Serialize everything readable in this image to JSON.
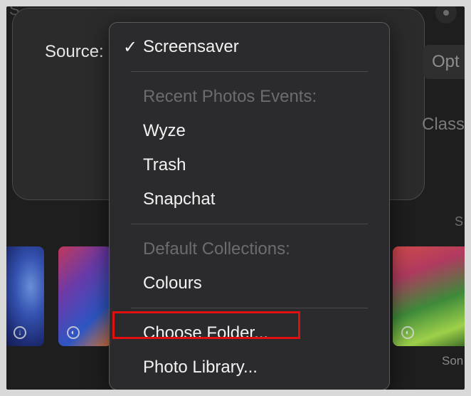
{
  "background": {
    "top_text": "S",
    "source_label": "Source:",
    "options_button": "Opt",
    "class_text": "Class",
    "side_letter": "S",
    "thumb_caption": "Son"
  },
  "menu": {
    "selected": {
      "check": "✓",
      "label": "Screensaver"
    },
    "sections": [
      {
        "header": "Recent Photos Events:",
        "items": [
          "Wyze",
          "Trash",
          "Snapchat"
        ]
      },
      {
        "header": "Default Collections:",
        "items": [
          "Colours"
        ]
      }
    ],
    "actions": [
      "Choose Folder...",
      "Photo Library..."
    ]
  },
  "annotation": {
    "highlighted_item": "Choose Folder...",
    "color": "#e01010"
  }
}
